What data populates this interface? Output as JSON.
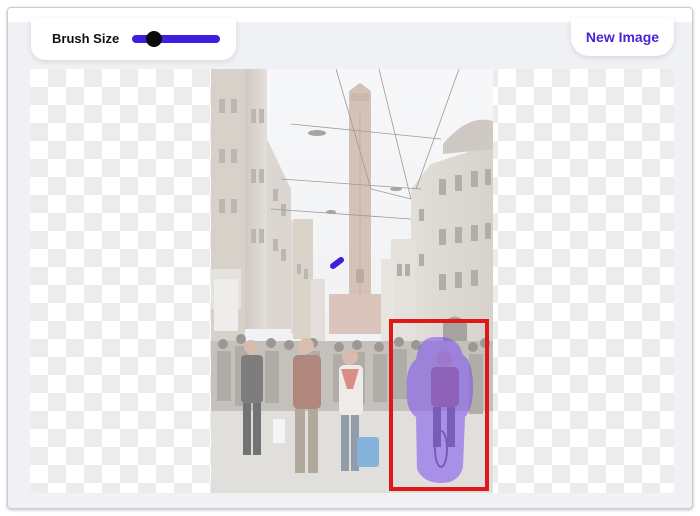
{
  "toolbar": {
    "brush_size_label": "Brush Size",
    "brush_size_fraction": 0.25,
    "new_image_label": "New Image"
  },
  "colors": {
    "accent": "#4a1fd6",
    "slider_track": "#3f1fdd",
    "mask": "#7b4ff0",
    "selection_box": "#e01818"
  },
  "icons": {
    "slider_thumb": "circle"
  }
}
